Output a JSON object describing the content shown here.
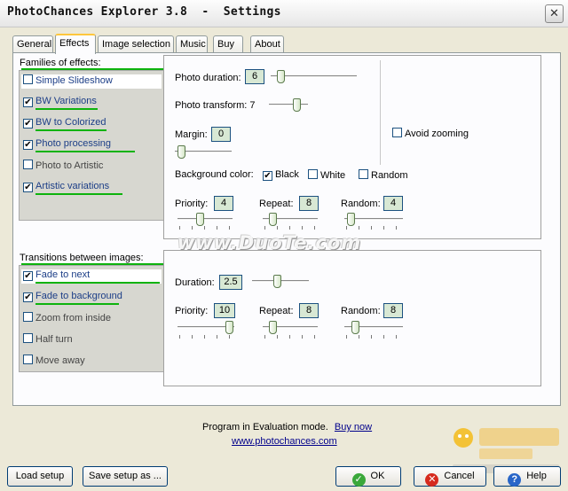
{
  "window": {
    "title": "PhotoChances Explorer 3.8  -  Settings",
    "close_glyph": "✕"
  },
  "tabs": [
    {
      "label": "General",
      "active": false
    },
    {
      "label": "Effects",
      "active": true
    },
    {
      "label": "Image selection",
      "active": false
    },
    {
      "label": "Music",
      "active": false
    },
    {
      "label": "Buy",
      "active": false
    },
    {
      "label": "About",
      "active": false
    }
  ],
  "effects": {
    "families_label": "Families of effects:",
    "families": [
      {
        "label": "Simple Slideshow",
        "checked": false,
        "selected": true
      },
      {
        "label": "BW Variations",
        "checked": true,
        "selected": false
      },
      {
        "label": "BW to Colorized",
        "checked": true,
        "selected": false
      },
      {
        "label": "Photo processing",
        "checked": true,
        "selected": false
      },
      {
        "label": "Photo to Artistic",
        "checked": false,
        "selected": false
      },
      {
        "label": "Artistic variations",
        "checked": true,
        "selected": false
      }
    ],
    "photo_duration": {
      "label": "Photo duration:",
      "value": "6",
      "level": 0.05
    },
    "photo_transform": {
      "label": "Photo transform: 7",
      "level": 0.7
    },
    "margin": {
      "label": "Margin:",
      "value": "0",
      "level": 0.0
    },
    "avoid_zooming": {
      "label": "Avoid zooming",
      "checked": false
    },
    "background_color": {
      "label": "Background color:",
      "options": [
        {
          "label": "Black",
          "checked": true
        },
        {
          "label": "White",
          "checked": false
        },
        {
          "label": "Random",
          "checked": false
        }
      ]
    },
    "priority": {
      "label": "Priority:",
      "value": "4",
      "level": 0.4
    },
    "repeat": {
      "label": "Repeat:",
      "value": "8",
      "level": 0.1
    },
    "random": {
      "label": "Random:",
      "value": "4",
      "level": 0.1
    }
  },
  "transitions": {
    "label": "Transitions between images:",
    "items": [
      {
        "label": "Fade to next",
        "checked": true,
        "selected": true
      },
      {
        "label": "Fade to background",
        "checked": true,
        "selected": false
      },
      {
        "label": "Zoom from inside",
        "checked": false,
        "selected": false
      },
      {
        "label": "Half turn",
        "checked": false,
        "selected": false
      },
      {
        "label": "Move away",
        "checked": false,
        "selected": false
      }
    ],
    "duration": {
      "label": "Duration:",
      "value": "2.5",
      "level": 0.45
    },
    "priority": {
      "label": "Priority:",
      "value": "10",
      "level": 0.9
    },
    "repeat": {
      "label": "Repeat:",
      "value": "8",
      "level": 0.15
    },
    "random": {
      "label": "Random:",
      "value": "8",
      "level": 0.15
    }
  },
  "watermark": "www.DuoTe.com",
  "footer": {
    "eval_text": "Program in Evaluation mode.",
    "buy_now": "Buy now",
    "website": "www.photochances.com"
  },
  "buttons": {
    "load_setup": "Load setup",
    "save_setup": "Save setup as ...",
    "ok": "OK",
    "cancel": "Cancel",
    "help": "Help"
  },
  "colors": {
    "accent_underline": "#0db30d",
    "value_box": "#d8e8d4",
    "tab_highlight": "#ffc73c"
  }
}
